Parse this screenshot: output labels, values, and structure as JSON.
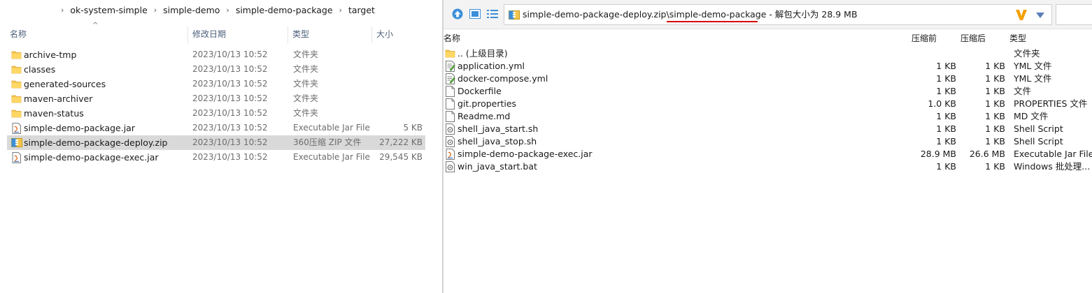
{
  "explorer": {
    "breadcrumb": [
      "ok-system-simple",
      "simple-demo",
      "simple-demo-package",
      "target"
    ],
    "columns": {
      "name": "名称",
      "date": "修改日期",
      "type": "类型",
      "size": "大小"
    },
    "files": [
      {
        "name": "archive-tmp",
        "date": "2023/10/13 10:52",
        "type": "文件夹",
        "size": "",
        "icon": "folder-icon"
      },
      {
        "name": "classes",
        "date": "2023/10/13 10:52",
        "type": "文件夹",
        "size": "",
        "icon": "folder-icon"
      },
      {
        "name": "generated-sources",
        "date": "2023/10/13 10:52",
        "type": "文件夹",
        "size": "",
        "icon": "folder-icon"
      },
      {
        "name": "maven-archiver",
        "date": "2023/10/13 10:52",
        "type": "文件夹",
        "size": "",
        "icon": "folder-icon"
      },
      {
        "name": "maven-status",
        "date": "2023/10/13 10:52",
        "type": "文件夹",
        "size": "",
        "icon": "folder-icon"
      },
      {
        "name": "simple-demo-package.jar",
        "date": "2023/10/13 10:52",
        "type": "Executable Jar File",
        "size": "5 KB",
        "icon": "jar-file-icon"
      },
      {
        "name": "simple-demo-package-deploy.zip",
        "date": "2023/10/13 10:52",
        "type": "360压缩 ZIP 文件",
        "size": "27,222 KB",
        "icon": "zip-archive-icon",
        "selected": true
      },
      {
        "name": "simple-demo-package-exec.jar",
        "date": "2023/10/13 10:52",
        "type": "Executable Jar File",
        "size": "29,545 KB",
        "icon": "jar-file-icon"
      }
    ]
  },
  "zipviewer": {
    "address_prefix": "simple-demo-package-deploy.zip\\",
    "address_folder": "simple-demo-package",
    "address_suffix": " - 解包大小为 28.9 MB",
    "colors": {
      "underline": "#d40000",
      "logo": "#f5a000",
      "nav": "#3b8fd9"
    },
    "columns": {
      "name": "名称",
      "compressed": "压缩前",
      "original": "压缩后",
      "type": "类型"
    },
    "files": [
      {
        "name": ".. (上级目录)",
        "before": "",
        "after": "",
        "type": "文件夹",
        "icon": "folder-icon"
      },
      {
        "name": "application.yml",
        "before": "1 KB",
        "after": "1 KB",
        "type": "YML 文件",
        "icon": "text-file-icon"
      },
      {
        "name": "docker-compose.yml",
        "before": "1 KB",
        "after": "1 KB",
        "type": "YML 文件",
        "icon": "text-file-icon"
      },
      {
        "name": "Dockerfile",
        "before": "1 KB",
        "after": "1 KB",
        "type": "文件",
        "icon": "blank-file-icon"
      },
      {
        "name": "git.properties",
        "before": "1.0 KB",
        "after": "1 KB",
        "type": "PROPERTIES 文件",
        "icon": "blank-file-icon"
      },
      {
        "name": "Readme.md",
        "before": "1 KB",
        "after": "1 KB",
        "type": "MD 文件",
        "icon": "blank-file-icon"
      },
      {
        "name": "shell_java_start.sh",
        "before": "1 KB",
        "after": "1 KB",
        "type": "Shell Script",
        "icon": "script-file-icon"
      },
      {
        "name": "shell_java_stop.sh",
        "before": "1 KB",
        "after": "1 KB",
        "type": "Shell Script",
        "icon": "script-file-icon"
      },
      {
        "name": "simple-demo-package-exec.jar",
        "before": "28.9 MB",
        "after": "26.6 MB",
        "type": "Executable Jar File",
        "icon": "jar-file-icon"
      },
      {
        "name": "win_java_start.bat",
        "before": "1 KB",
        "after": "1 KB",
        "type": "Windows 批处理...",
        "icon": "script-file-icon"
      }
    ]
  }
}
